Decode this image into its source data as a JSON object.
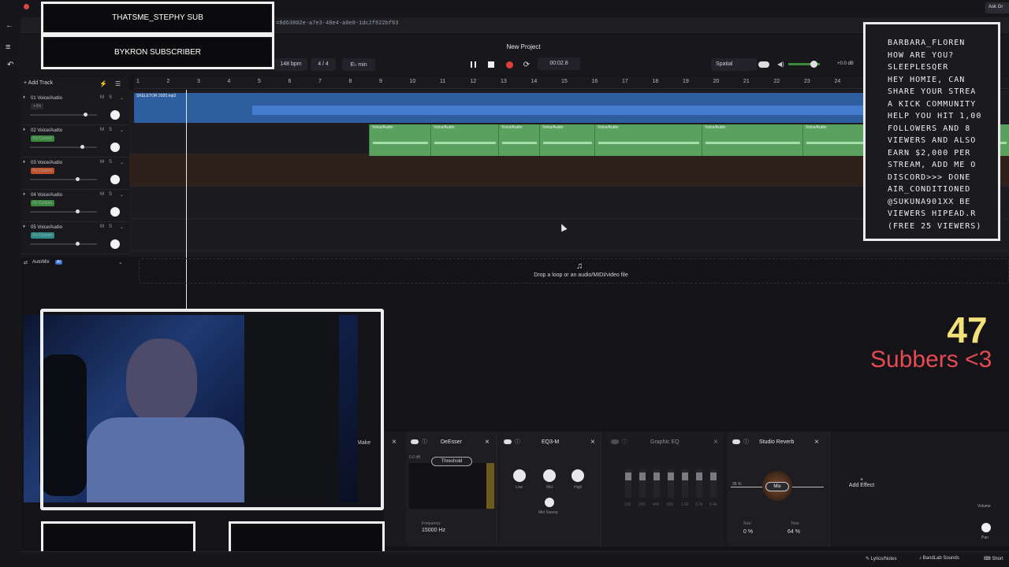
{
  "browser": {
    "url_fragment": "=8d63802e-a7e3-48e4-a0e0-1dc2f822bf83",
    "ask_label": "Ask Gr"
  },
  "overlay": {
    "banner_top": "THATSME_STEPHY SUB",
    "banner_mid": "BYKRON SUBSCRIBER",
    "subs_count": "47",
    "subs_text": "Subbers <3",
    "chat_lines": [
      "BARBARA_FLOREN",
      "HOW ARE YOU?",
      "SLEEPLESQER",
      "HEY HOMIE, CAN",
      "SHARE YOUR STREA",
      "A KICK COMMUNITY",
      "HELP YOU HIT 1,00",
      "FOLLOWERS AND 8",
      "VIEWERS AND ALSO",
      "EARN $2,000 PER",
      "STREAM, ADD ME O",
      "DISCORD>>> DONE",
      "AIR_CONDITIONED",
      "@SUKUNA901XX BE",
      "VIEWERS HIPEAD.R",
      "(FREE 25 VIEWERS)"
    ]
  },
  "header": {
    "project_title": "New Project",
    "bpm": "148 bpm",
    "time_signature": "4 / 4",
    "key": "E♭ min",
    "time_display": "00:02.8",
    "spatial_label": "Spatial",
    "save_label": "Save",
    "level": "+0.0 dB"
  },
  "ruler": {
    "bars": [
      "1",
      "2",
      "3",
      "4",
      "5",
      "6",
      "7",
      "8",
      "9",
      "10",
      "11",
      "12",
      "13",
      "14",
      "15",
      "16",
      "17",
      "18",
      "19",
      "20",
      "21",
      "22",
      "23",
      "24"
    ]
  },
  "tracks": {
    "add_track_label": "Add Track",
    "items": [
      {
        "name": "01 Voice/Audio",
        "fx": "+ Fx",
        "fx_color": "#2a2a30",
        "volume": 0.85
      },
      {
        "name": "02 Voice/Audio",
        "fx": "Fx Custom",
        "fx_color": "#3c8a3e",
        "volume": 0.8
      },
      {
        "name": "03 Voice/Audio",
        "fx": "Fx Custom",
        "fx_color": "#c2502a",
        "volume": 0.72
      },
      {
        "name": "04 Voice/Audio",
        "fx": "Fx Custom",
        "fx_color": "#3c8a3e",
        "volume": 0.72
      },
      {
        "name": "05 Voice/Audio",
        "fx": "Fx Custom",
        "fx_color": "#2f8a8a",
        "volume": 0.72
      }
    ],
    "mute": "M",
    "solo": "S",
    "automix_label": "AutoMix"
  },
  "clips": {
    "blue_label": "SKELETOR 2020.mp3",
    "green_label": "Voice/Audio"
  },
  "dropzone": {
    "text": "Drop a loop or an audio/MIDI/video file"
  },
  "effects": {
    "partial_label": "Make",
    "cards": [
      {
        "title": "DeEsser",
        "threshold": "Threshold",
        "freq_label": "Frequency",
        "freq_value": "15000 Hz",
        "db": "0.0 dB"
      },
      {
        "title": "EQ3-M",
        "knobs": [
          "Low",
          "Mid",
          "High"
        ],
        "sweep": "Mid Sweep"
      },
      {
        "title": "Graphic EQ",
        "bands": [
          "100",
          "200",
          "400",
          "800",
          "1.6k",
          "3.2k",
          "6.4k"
        ]
      },
      {
        "title": "Studio Reverb",
        "mix": "Mix",
        "size_label": "Size",
        "size_value": "0 %",
        "tone_label": "Tone",
        "tone_value": "64 %",
        "percent": "35 %"
      }
    ],
    "add_effect": "Add Effect",
    "volume_label": "Volume",
    "pan_label": "Pan",
    "large_hall": "Large Hall"
  },
  "bottom": {
    "lyrics": "Lyrics/Notes",
    "sounds": "BandLab Sounds",
    "shortcuts": "Short"
  }
}
